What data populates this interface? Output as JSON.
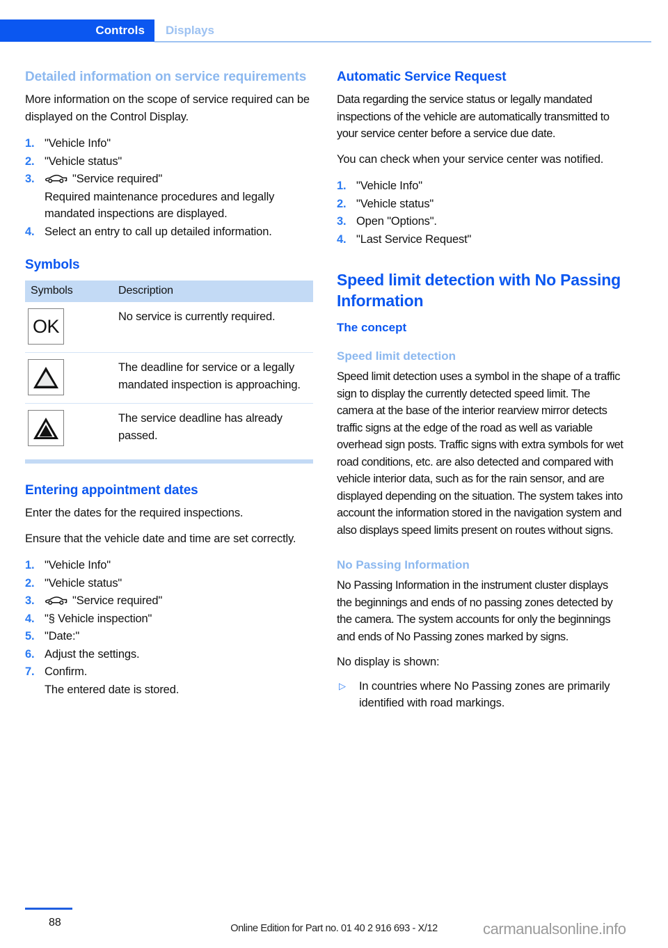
{
  "header": {
    "tab_active": "Controls",
    "tab_inactive": "Displays"
  },
  "left_column": {
    "section1": {
      "heading": "Detailed information on service requirements",
      "intro": "More information on the scope of service required can be displayed on the Control Display.",
      "steps": [
        {
          "num": "1.",
          "text": "\"Vehicle Info\"",
          "icon": ""
        },
        {
          "num": "2.",
          "text": "\"Vehicle status\"",
          "icon": ""
        },
        {
          "num": "3.",
          "text": "\"Service required\"",
          "icon": "car-icon"
        },
        {
          "num": "4.",
          "text": "Select an entry to call up detailed information."
        }
      ],
      "step3_note": "Required maintenance procedures and legally mandated inspections are displayed."
    },
    "symbols_section": {
      "heading": "Symbols",
      "columns": [
        "Symbols",
        "Description"
      ],
      "rows": [
        {
          "symbol": "OK",
          "symbol_kind": "ok-text",
          "description": "No service is currently required."
        },
        {
          "symbol": "",
          "symbol_kind": "triangle-outline",
          "description": "The deadline for service or a legally mandated inspection is approaching."
        },
        {
          "symbol": "",
          "symbol_kind": "triangle-filled",
          "description": "The service deadline has already passed."
        }
      ]
    },
    "section3": {
      "heading": "Entering appointment dates",
      "para1": "Enter the dates for the required inspections.",
      "para2": "Ensure that the vehicle date and time are set correctly.",
      "steps": [
        {
          "num": "1.",
          "text": "\"Vehicle Info\""
        },
        {
          "num": "2.",
          "text": "\"Vehicle status\""
        },
        {
          "num": "3.",
          "text": "\"Service required\"",
          "icon": "car-icon"
        },
        {
          "num": "4.",
          "text": "\"§ Vehicle inspection\""
        },
        {
          "num": "5.",
          "text": "\"Date:\""
        },
        {
          "num": "6.",
          "text": "Adjust the settings."
        },
        {
          "num": "7.",
          "text": "Confirm."
        }
      ],
      "step7_note": "The entered date is stored."
    }
  },
  "right_column": {
    "section1": {
      "heading": "Automatic Service Request",
      "para1": "Data regarding the service status or legally mandated inspections of the vehicle are automatically transmitted to your service center before a service due date.",
      "para2": "You can check when your service center was notified.",
      "steps": [
        {
          "num": "1.",
          "text": "\"Vehicle Info\""
        },
        {
          "num": "2.",
          "text": "\"Vehicle status\""
        },
        {
          "num": "3.",
          "text": "Open \"Options\"."
        },
        {
          "num": "4.",
          "text": "\"Last Service Request\""
        }
      ]
    },
    "section2": {
      "heading": "Speed limit detection with No Passing Information",
      "subheading": "The concept",
      "sub1": {
        "heading": "Speed limit detection",
        "body": "Speed limit detection uses a symbol in the shape of a traffic sign to display the currently detected speed limit. The camera at the base of the interior rearview mirror detects traffic signs at the edge of the road as well as variable overhead sign posts. Traffic signs with extra symbols for wet road conditions, etc. are also detected and compared with vehicle interior data, such as for the rain sensor, and are displayed depending on the situation. The system takes into account the information stored in the navigation system and also displays speed limits present on routes without signs."
      },
      "sub2": {
        "heading": "No Passing Information",
        "body": "No Passing Information in the instrument cluster displays the beginnings and ends of no passing zones detected by the camera. The system accounts for only the beginnings and ends of No Passing zones marked by signs.",
        "lead": "No display is shown:",
        "bullets": [
          "In countries where No Passing zones are primarily identified with road markings."
        ]
      }
    }
  },
  "footer": {
    "page_number": "88",
    "edition_text": "Online Edition for Part no. 01 40 2 916 693 - X/12",
    "watermark": "carmanualsonline.info"
  },
  "colors": {
    "accent_blue": "#0b57f0",
    "light_blue_heading": "#8cb8ef",
    "table_header_bg": "#c3daf5",
    "number_blue": "#2b7bf3"
  }
}
